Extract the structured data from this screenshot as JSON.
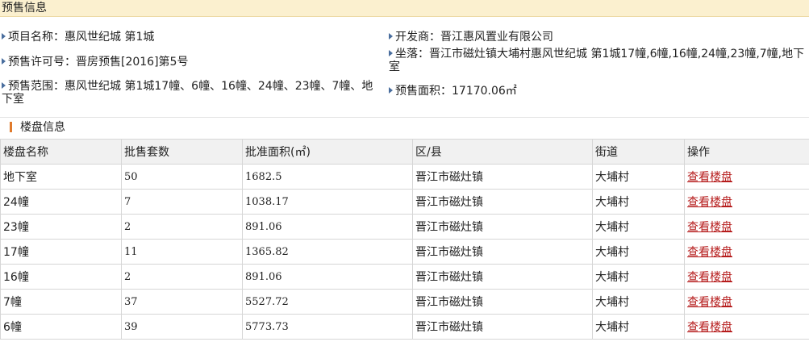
{
  "section_title": "预售信息",
  "project": {
    "name": "项目名称：惠风世纪城 第1城",
    "license": "预售许可号：晋房预售[2016]第5号",
    "scope": "预售范围：惠风世纪城 第1城17幢、6幢、16幢、24幢、23幢、7幢、地下室",
    "developer": "开发商：晋江惠风置业有限公司",
    "location": "坐落：晋江市磁灶镇大埔村惠风世纪城 第1城17幢,6幢,16幢,24幢,23幢,7幢,地下室",
    "area": "预售面积：17170.06㎡"
  },
  "building_section_title": "楼盘信息",
  "table": {
    "headers": [
      "楼盘名称",
      "批售套数",
      "批准面积(㎡)",
      "区/县",
      "街道",
      "操作"
    ],
    "rows": [
      {
        "name": "地下室",
        "units": "50",
        "area": "1682.5",
        "district": "晋江市磁灶镇",
        "street": "大埔村",
        "action": "查看楼盘"
      },
      {
        "name": "24幢",
        "units": "7",
        "area": "1038.17",
        "district": "晋江市磁灶镇",
        "street": "大埔村",
        "action": "查看楼盘"
      },
      {
        "name": "23幢",
        "units": "2",
        "area": "891.06",
        "district": "晋江市磁灶镇",
        "street": "大埔村",
        "action": "查看楼盘"
      },
      {
        "name": "17幢",
        "units": "11",
        "area": "1365.82",
        "district": "晋江市磁灶镇",
        "street": "大埔村",
        "action": "查看楼盘"
      },
      {
        "name": "16幢",
        "units": "2",
        "area": "891.06",
        "district": "晋江市磁灶镇",
        "street": "大埔村",
        "action": "查看楼盘"
      },
      {
        "name": "7幢",
        "units": "37",
        "area": "5527.72",
        "district": "晋江市磁灶镇",
        "street": "大埔村",
        "action": "查看楼盘"
      },
      {
        "name": "6幢",
        "units": "39",
        "area": "5773.73",
        "district": "晋江市磁灶镇",
        "street": "大埔村",
        "action": "查看楼盘"
      }
    ]
  },
  "colors": {
    "header_bg": "#fbf0cf",
    "link": "#b61c1c",
    "arrow": "#4a6e9e",
    "accent_bar": "#e07a2c"
  },
  "icons": {
    "bullet": "triangle-right-icon",
    "section_marker": "orange-bar-icon"
  }
}
